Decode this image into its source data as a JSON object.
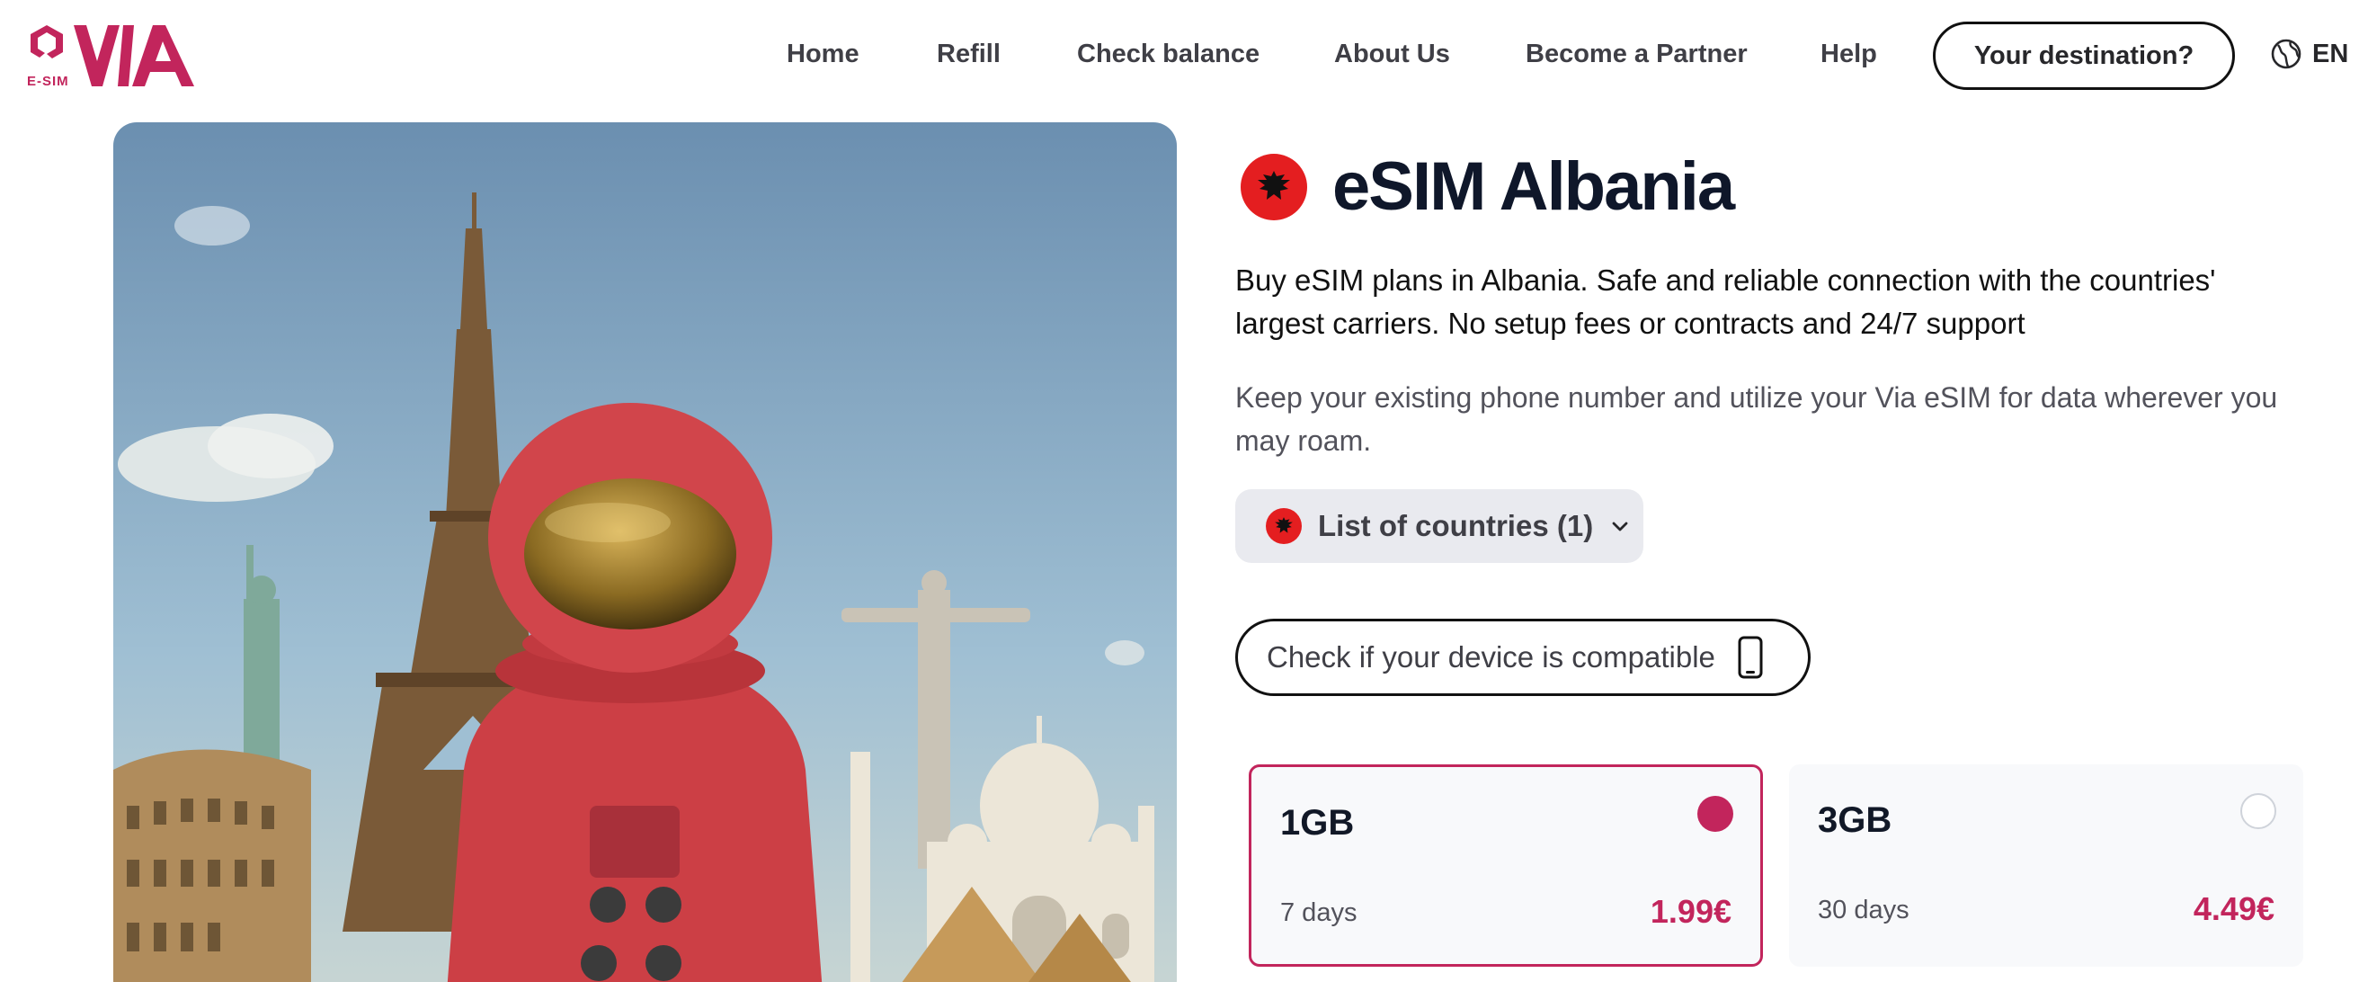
{
  "header": {
    "logo_text": "VIA",
    "logo_sub": "E-SIM",
    "nav": [
      {
        "label": "Home"
      },
      {
        "label": "Refill"
      },
      {
        "label": "Check balance"
      },
      {
        "label": "About Us"
      },
      {
        "label": "Become a Partner"
      },
      {
        "label": "Help"
      }
    ],
    "destination_button": "Your destination?",
    "language": "EN"
  },
  "main": {
    "title": "eSIM Albania",
    "lead": "Buy eSIM plans in Albania. Safe and reliable connection with the countries' largest carriers. No setup fees or contracts and 24/7 support",
    "sub": "Keep your existing phone number and utilize your Via eSIM for data wherever you may roam.",
    "countries_button": "List of countries (1)",
    "compat_button": "Check if your device is compatible",
    "plans": [
      {
        "size": "1GB",
        "days": "7 days",
        "price": "1.99€",
        "selected": true
      },
      {
        "size": "3GB",
        "days": "30 days",
        "price": "4.49€",
        "selected": false
      }
    ]
  },
  "colors": {
    "brand": "#c2255c",
    "albania_red": "#e41e20"
  },
  "icons": {
    "logo": "via-logo-icon",
    "globe": "globe-icon",
    "chevron": "chevron-down-icon",
    "phone": "phone-icon",
    "flag": "albania-flag-icon"
  }
}
